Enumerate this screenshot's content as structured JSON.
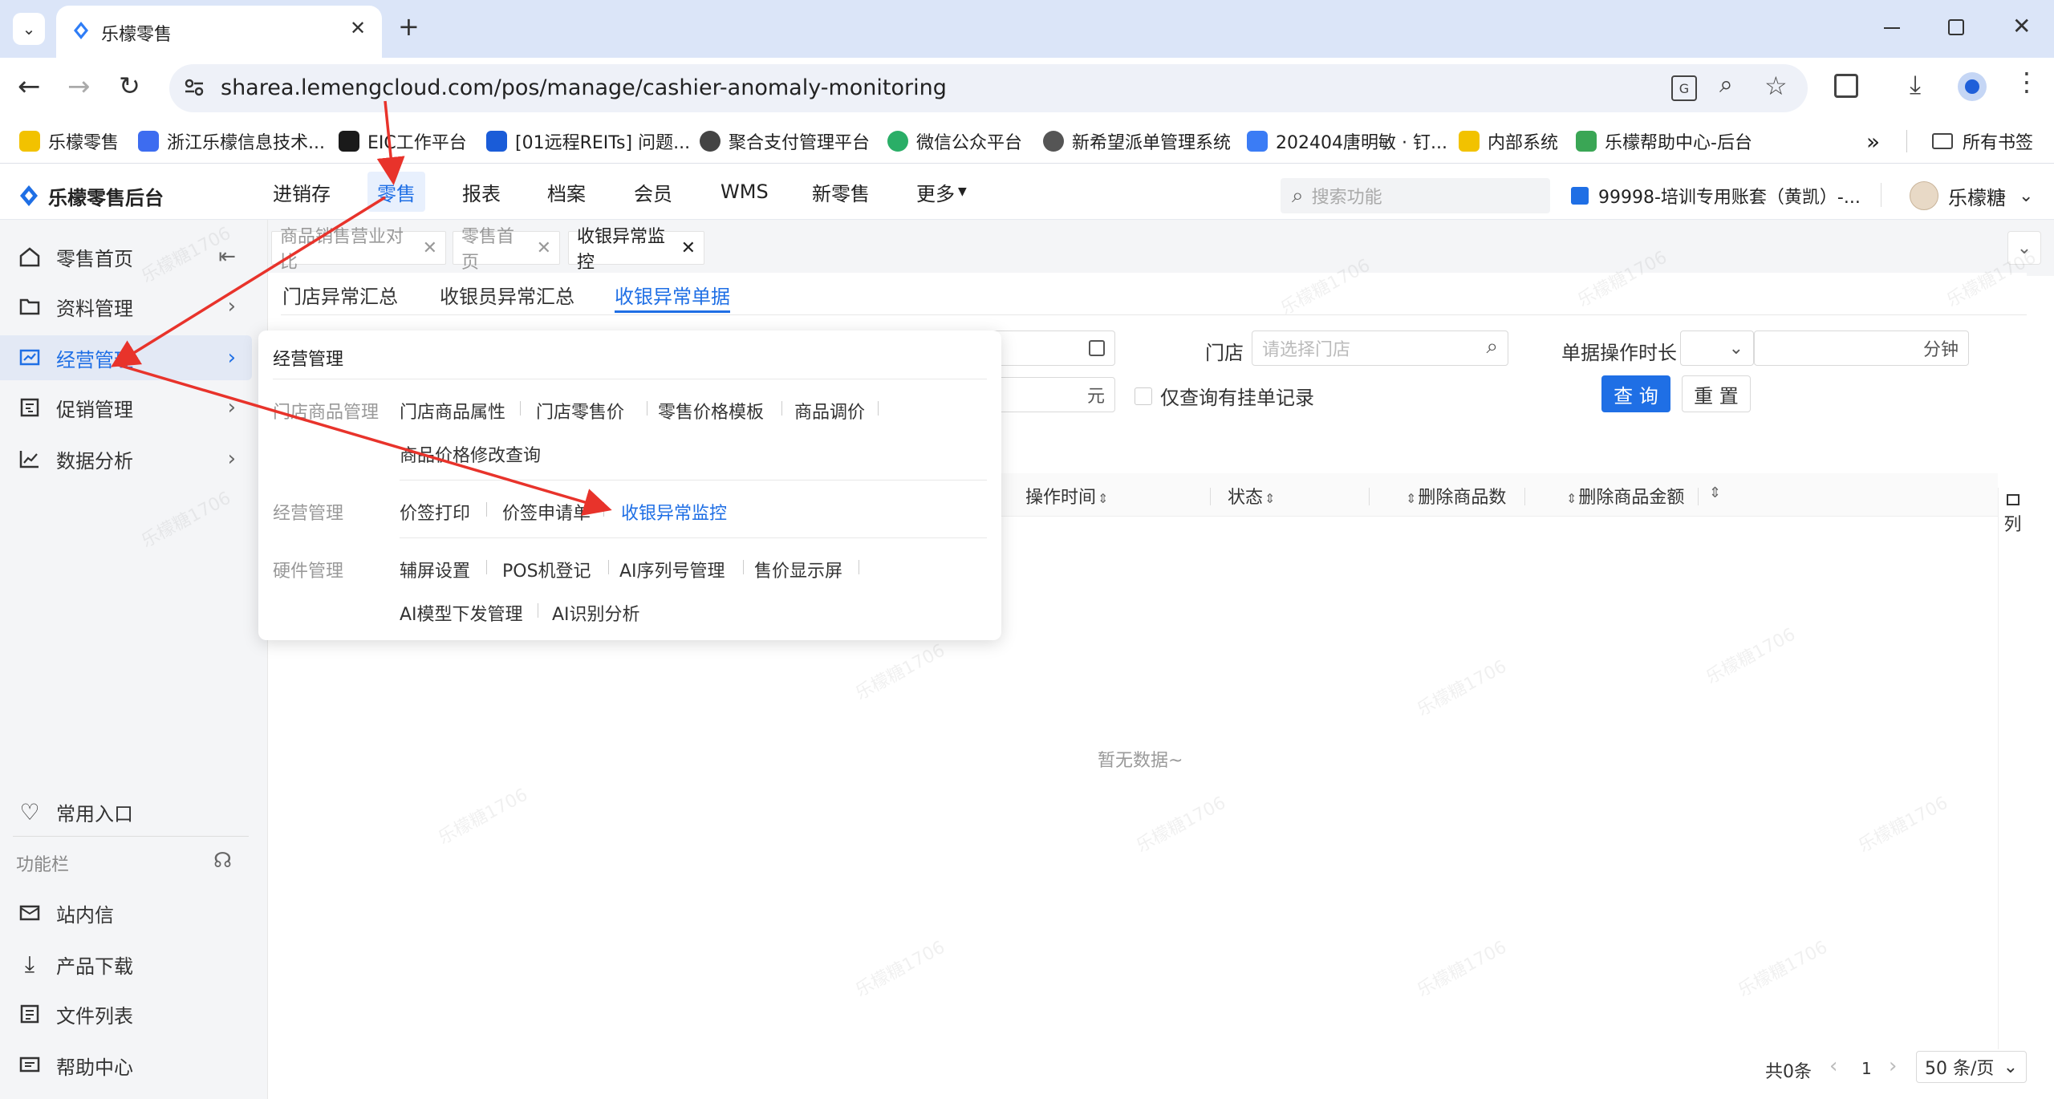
{
  "browser": {
    "tab_title": "乐檬零售",
    "url": "sharea.lemengcloud.com/pos/manage/cashier-anomaly-monitoring",
    "bookmarks": [
      {
        "label": "乐檬零售",
        "color": "#f2c200"
      },
      {
        "label": "浙江乐檬信息技术...",
        "color": "#3d6cf0"
      },
      {
        "label": "EIC工作平台",
        "color": "#1a1a1a"
      },
      {
        "label": "[01远程REITs] 问题...",
        "color": "#1a5cd8"
      },
      {
        "label": "聚合支付管理平台",
        "color": "#444444"
      },
      {
        "label": "微信公众平台",
        "color": "#2aae67"
      },
      {
        "label": "新希望派单管理系统",
        "color": "#555555"
      },
      {
        "label": "202404唐明敏 · 钉...",
        "color": "#3b7cf5"
      },
      {
        "label": "内部系统",
        "color": "#f2c200"
      },
      {
        "label": "乐檬帮助中心-后台",
        "color": "#3aa655"
      }
    ],
    "bookmarks_overflow": "»",
    "all_bookmarks": "所有书签"
  },
  "app": {
    "logo_text": "乐檬零售后台",
    "nav": [
      "进销存",
      "零售",
      "报表",
      "档案",
      "会员",
      "WMS",
      "新零售",
      "更多"
    ],
    "search_placeholder": "搜索功能",
    "account": "99998-培训专用账套（黄凯）-...",
    "user": "乐檬糖"
  },
  "sidebar": {
    "items": [
      "零售首页",
      "资料管理",
      "经营管理",
      "促销管理",
      "数据分析"
    ],
    "common": "常用入口",
    "func_bar": "功能栏",
    "bottom": [
      "站内信",
      "产品下载",
      "文件列表",
      "帮助中心"
    ]
  },
  "page_tabs": [
    "商品销售营业对比",
    "零售首页",
    "收银异常监控"
  ],
  "sub_tabs": [
    "门店异常汇总",
    "收银员异常汇总",
    "收银异常单据"
  ],
  "filters": {
    "store_label": "门店",
    "store_placeholder": "请选择门店",
    "duration_label": "单据操作时长",
    "duration_unit": "分钟",
    "amount_unit": "元",
    "hang_only": "仅查询有挂单记录",
    "query_btn": "查 询",
    "reset_btn": "重 置"
  },
  "table": {
    "headers": [
      "操作时间",
      "状态",
      "删除商品数",
      "删除商品金额"
    ],
    "column_btn": "列",
    "empty": "暂无数据~"
  },
  "pagination": {
    "total": "共0条",
    "page": "1",
    "size": "50 条/页"
  },
  "popup": {
    "title": "经营管理",
    "groups": [
      {
        "label": "门店商品管理",
        "items": [
          "门店商品属性",
          "门店零售价",
          "零售价格模板",
          "商品调价",
          "商品价格修改查询"
        ]
      },
      {
        "label": "经营管理",
        "items": [
          "价签打印",
          "价签申请单",
          "收银异常监控"
        ]
      },
      {
        "label": "硬件管理",
        "items": [
          "辅屏设置",
          "POS机登记",
          "AI序列号管理",
          "售价显示屏",
          "AI模型下发管理",
          "AI识别分析"
        ]
      }
    ]
  },
  "watermark": "乐檬糖1706",
  "colors": {
    "accent": "#1f6fe5",
    "annotation": "#e8332b"
  }
}
